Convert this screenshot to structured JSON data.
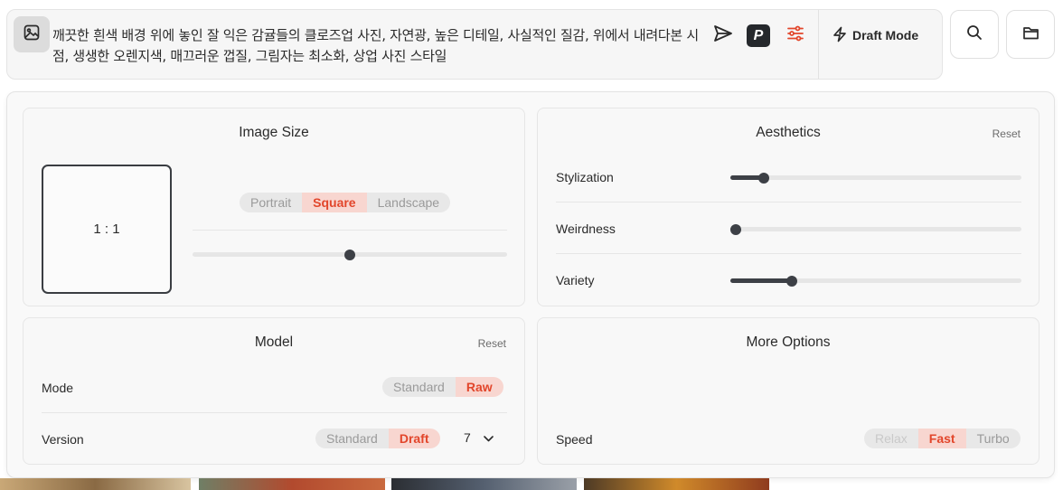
{
  "prompt": {
    "text": "깨끗한 흰색 배경 위에 놓인 잘 익은 감귤들의 클로즈업 사진, 자연광, 높은 디테일, 사실적인 질감, 위에서 내려다본 시점, 생생한 오렌지색, 매끄러운 껍질, 그림자는 최소화, 상업 사진 스타일",
    "p_label": "P",
    "draft_mode_label": "Draft Mode"
  },
  "image_size": {
    "title": "Image Size",
    "ratio": "1 : 1",
    "orientation_options": [
      "Portrait",
      "Square",
      "Landscape"
    ],
    "orientation_selected": "Square",
    "ratio_slider_value": 0.5
  },
  "aesthetics": {
    "title": "Aesthetics",
    "reset": "Reset",
    "sliders": [
      {
        "label": "Stylization",
        "value": 0.1
      },
      {
        "label": "Weirdness",
        "value": 0.0
      },
      {
        "label": "Variety",
        "value": 0.2
      }
    ]
  },
  "model": {
    "title": "Model",
    "reset": "Reset",
    "mode_label": "Mode",
    "mode_options": [
      "Standard",
      "Raw"
    ],
    "mode_selected": "Raw",
    "version_label": "Version",
    "version_options": [
      "Standard",
      "Draft"
    ],
    "version_selected": "Draft",
    "version_number": "7"
  },
  "more_options": {
    "title": "More Options",
    "speed_label": "Speed",
    "speed_options": [
      "Relax",
      "Fast",
      "Turbo"
    ],
    "speed_selected": "Fast",
    "speed_disabled": "Relax"
  },
  "colors": {
    "accent": "#e2462b",
    "accent_bg": "#f8d6d0",
    "slider": "#3d4046"
  }
}
